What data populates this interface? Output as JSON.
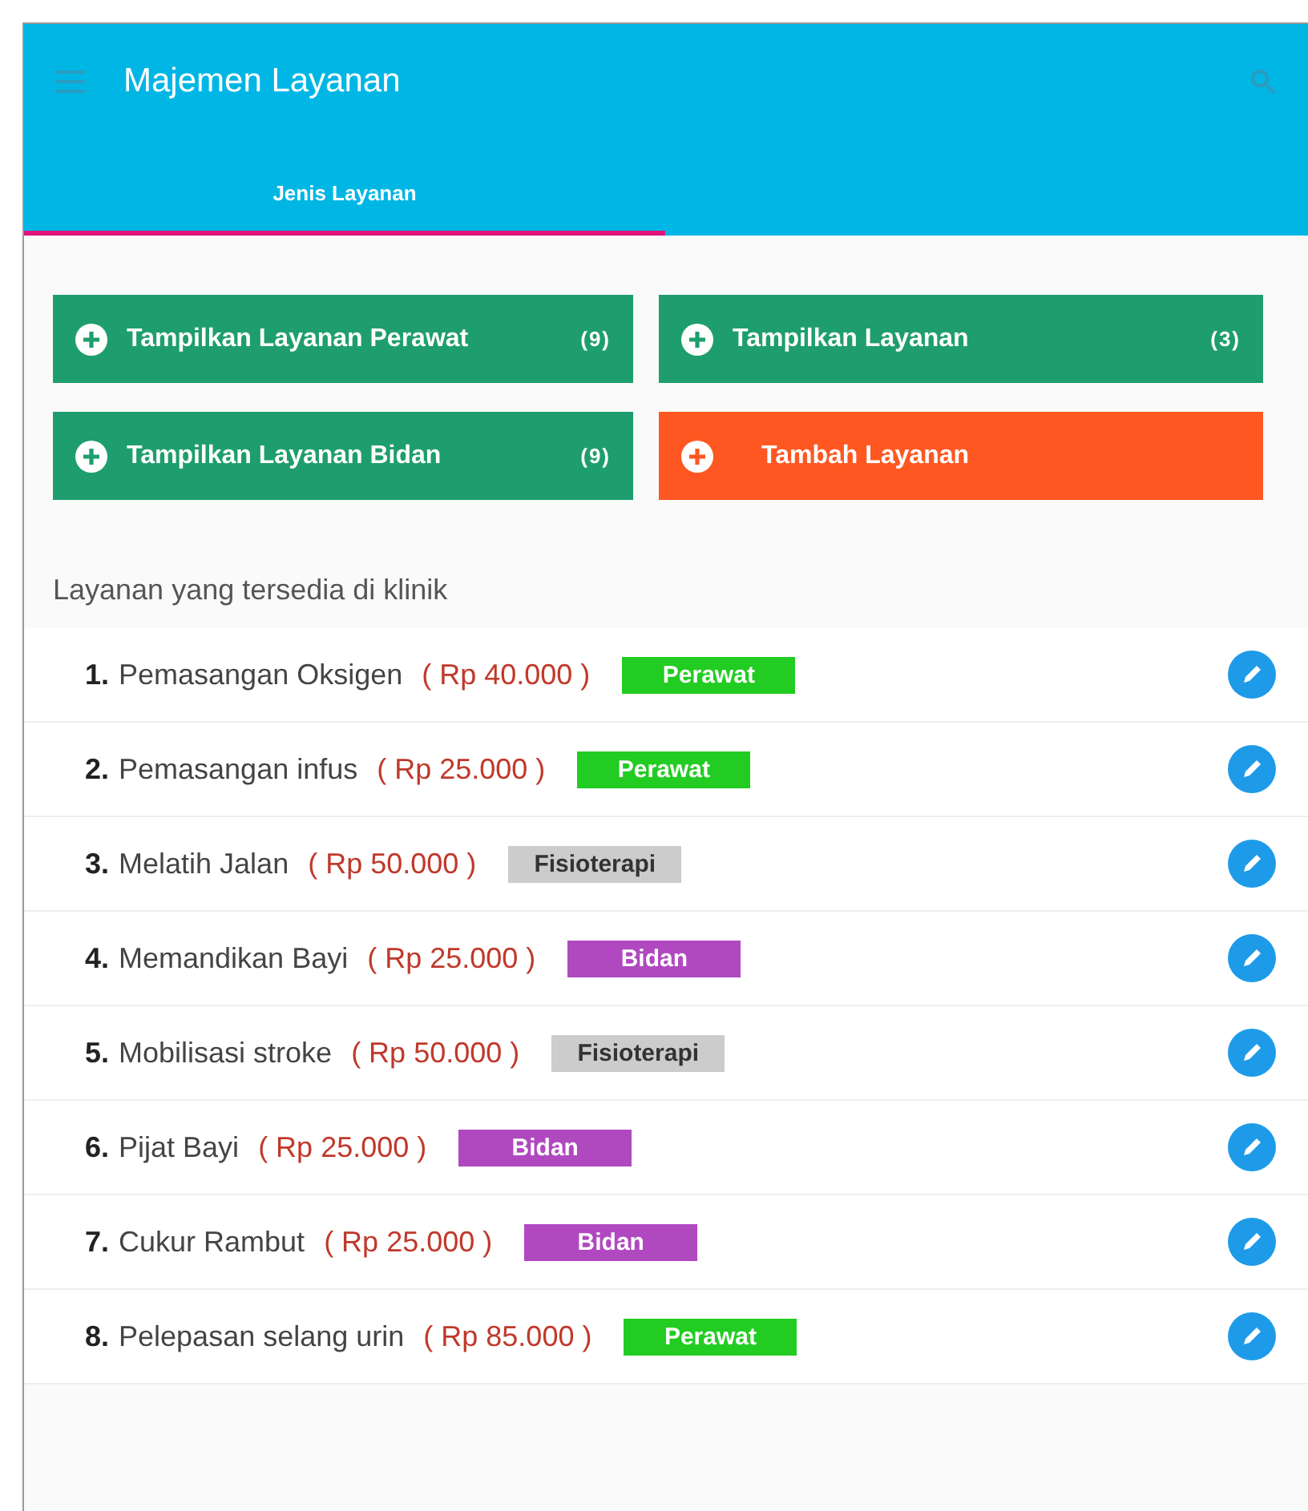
{
  "app_bar": {
    "title": "Majemen Layanan"
  },
  "tabs": [
    {
      "label": "Jenis Layanan",
      "selected": true
    }
  ],
  "buttons": [
    {
      "kind": "show",
      "label": "Tampilkan Layanan Perawat",
      "count": "(9)"
    },
    {
      "kind": "show",
      "label": "Tampilkan Layanan",
      "count": "(3)"
    },
    {
      "kind": "show",
      "label": "Tampilkan Layanan Bidan",
      "count": "(9)"
    },
    {
      "kind": "add",
      "label": "Tambah Layanan"
    }
  ],
  "section_title": "Layanan yang tersedia di klinik",
  "services": [
    {
      "number": "1.",
      "name": "Pemasangan Oksigen",
      "price": "( Rp 40.000 )",
      "tag": "Perawat",
      "color": "#22cc22"
    },
    {
      "number": "2.",
      "name": "Pemasangan infus",
      "price": "( Rp 25.000 )",
      "tag": "Perawat",
      "color": "#22cc22"
    },
    {
      "number": "3.",
      "name": "Melatih Jalan",
      "price": "( Rp 50.000 )",
      "tag": "Fisioterapi",
      "color": "#cccccc"
    },
    {
      "number": "4.",
      "name": "Memandikan Bayi",
      "price": "( Rp 25.000 )",
      "tag": "Bidan",
      "color": "#b048c0"
    },
    {
      "number": "5.",
      "name": "Mobilisasi stroke",
      "price": "( Rp 50.000 )",
      "tag": "Fisioterapi",
      "color": "#cccccc"
    },
    {
      "number": "6.",
      "name": "Pijat Bayi",
      "price": "( Rp 25.000 )",
      "tag": "Bidan",
      "color": "#b048c0"
    },
    {
      "number": "7.",
      "name": "Cukur Rambut",
      "price": "( Rp 25.000 )",
      "tag": "Bidan",
      "color": "#b048c0"
    },
    {
      "number": "8.",
      "name": "Pelepasan selang urin",
      "price": "( Rp 85.000 )",
      "tag": "Perawat",
      "color": "#22cc22"
    }
  ]
}
